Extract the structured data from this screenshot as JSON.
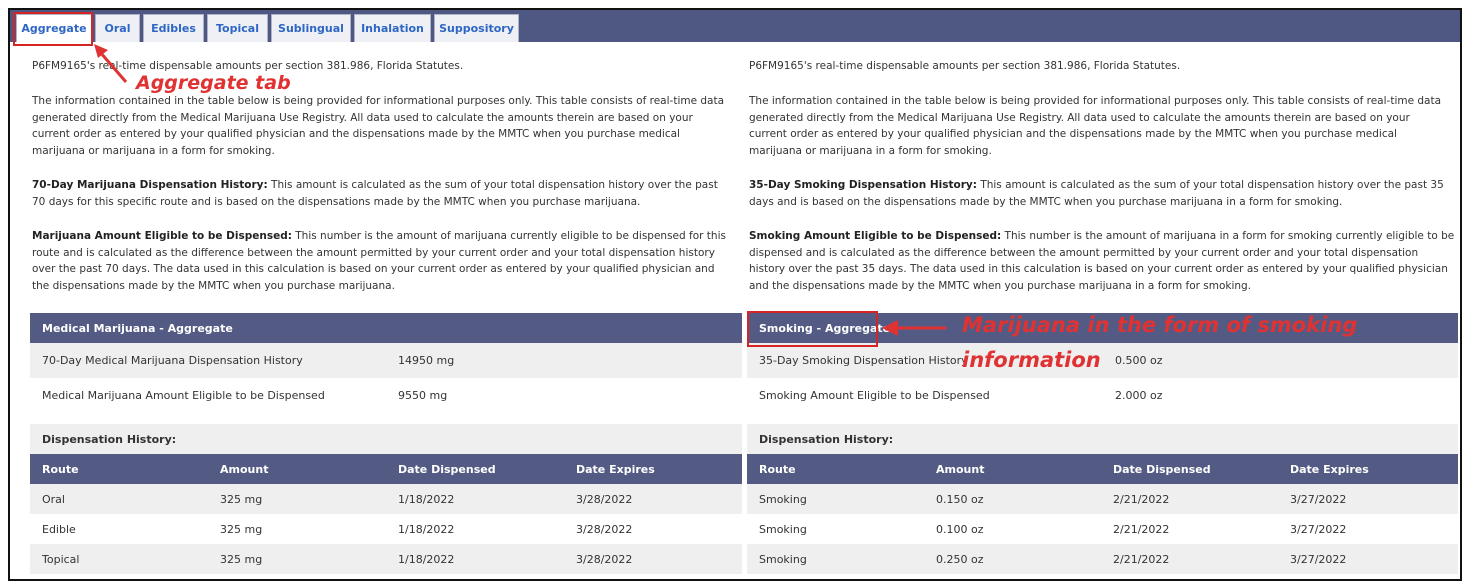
{
  "tabs": [
    "Aggregate",
    "Oral",
    "Edibles",
    "Topical",
    "Sublingual",
    "Inhalation",
    "Suppository"
  ],
  "left": {
    "intro": "P6FM9165's real-time dispensable amounts per section 381.986, Florida Statutes.",
    "info": "The information contained in the table below is being provided for informational purposes only. This table consists of real-time data generated directly from the Medical Marijuana Use Registry. All data used to calculate the amounts therein are based on your current order as entered by your qualified physician and the dispensations made by the MMTC when you purchase medical marijuana or marijuana in a form for smoking.",
    "history_term": "70-Day Marijuana Dispensation History:",
    "history_def": "This amount is calculated as the sum of your total dispensation history over the past 70 days for this specific route and is based on the dispensations made by the MMTC when you purchase marijuana.",
    "eligible_term": "Marijuana Amount Eligible to be Dispensed:",
    "eligible_def": "This number is the amount of marijuana currently eligible to be dispensed for this route and is calculated as the difference between the amount permitted by your current order and your total dispensation history over the past 70 days. The data used in this calculation is based on your current order as entered by your qualified physician and the dispensations made by the MMTC when you purchase marijuana.",
    "section_title": "Medical Marijuana - Aggregate",
    "summary": [
      {
        "label": "70-Day Medical Marijuana Dispensation History",
        "value": "14950 mg"
      },
      {
        "label": "Medical Marijuana Amount Eligible to be Dispensed",
        "value": "9550 mg"
      }
    ],
    "dh_label": "Dispensation History:",
    "headers": [
      "Route",
      "Amount",
      "Date Dispensed",
      "Date Expires"
    ],
    "rows": [
      [
        "Oral",
        "325 mg",
        "1/18/2022",
        "3/28/2022"
      ],
      [
        "Edible",
        "325 mg",
        "1/18/2022",
        "3/28/2022"
      ],
      [
        "Topical",
        "325 mg",
        "1/18/2022",
        "3/28/2022"
      ]
    ]
  },
  "right": {
    "intro": "P6FM9165's real-time dispensable amounts per section 381.986, Florida Statutes.",
    "info": "The information contained in the table below is being provided for informational purposes only. This table consists of real-time data generated directly from the Medical Marijuana Use Registry. All data used to calculate the amounts therein are based on your current order as entered by your qualified physician and the dispensations made by the MMTC when you purchase medical marijuana or marijuana in a form for smoking.",
    "history_term": "35-Day Smoking Dispensation History:",
    "history_def": "This amount is calculated as the sum of your total dispensation history over the past 35 days and is based on the dispensations made by the MMTC when you purchase marijuana in a form for smoking.",
    "eligible_term": "Smoking Amount Eligible to be Dispensed:",
    "eligible_def": "This number is the amount of marijuana in a form for smoking currently eligible to be dispensed and is calculated as the difference between the amount permitted by your current order and your total dispensation history over the past 35 days. The data used in this calculation is based on your current order as entered by your qualified physician and the dispensations made by the MMTC when you purchase marijuana in a form for smoking.",
    "section_title": "Smoking - Aggregate",
    "summary": [
      {
        "label": "35-Day Smoking Dispensation History",
        "value": "0.500 oz"
      },
      {
        "label": "Smoking Amount Eligible to be Dispensed",
        "value": "2.000 oz"
      }
    ],
    "dh_label": "Dispensation History:",
    "headers": [
      "Route",
      "Amount",
      "Date Dispensed",
      "Date Expires"
    ],
    "rows": [
      [
        "Smoking",
        "0.150 oz",
        "2/21/2022",
        "3/27/2022"
      ],
      [
        "Smoking",
        "0.100 oz",
        "2/21/2022",
        "3/27/2022"
      ],
      [
        "Smoking",
        "0.250 oz",
        "2/21/2022",
        "3/27/2022"
      ]
    ]
  },
  "annotations": {
    "aggregate_tab": "Aggregate tab",
    "smoking_line1": "Marijuana in the form of smoking",
    "smoking_line2": "information",
    "color": "#e03232"
  }
}
